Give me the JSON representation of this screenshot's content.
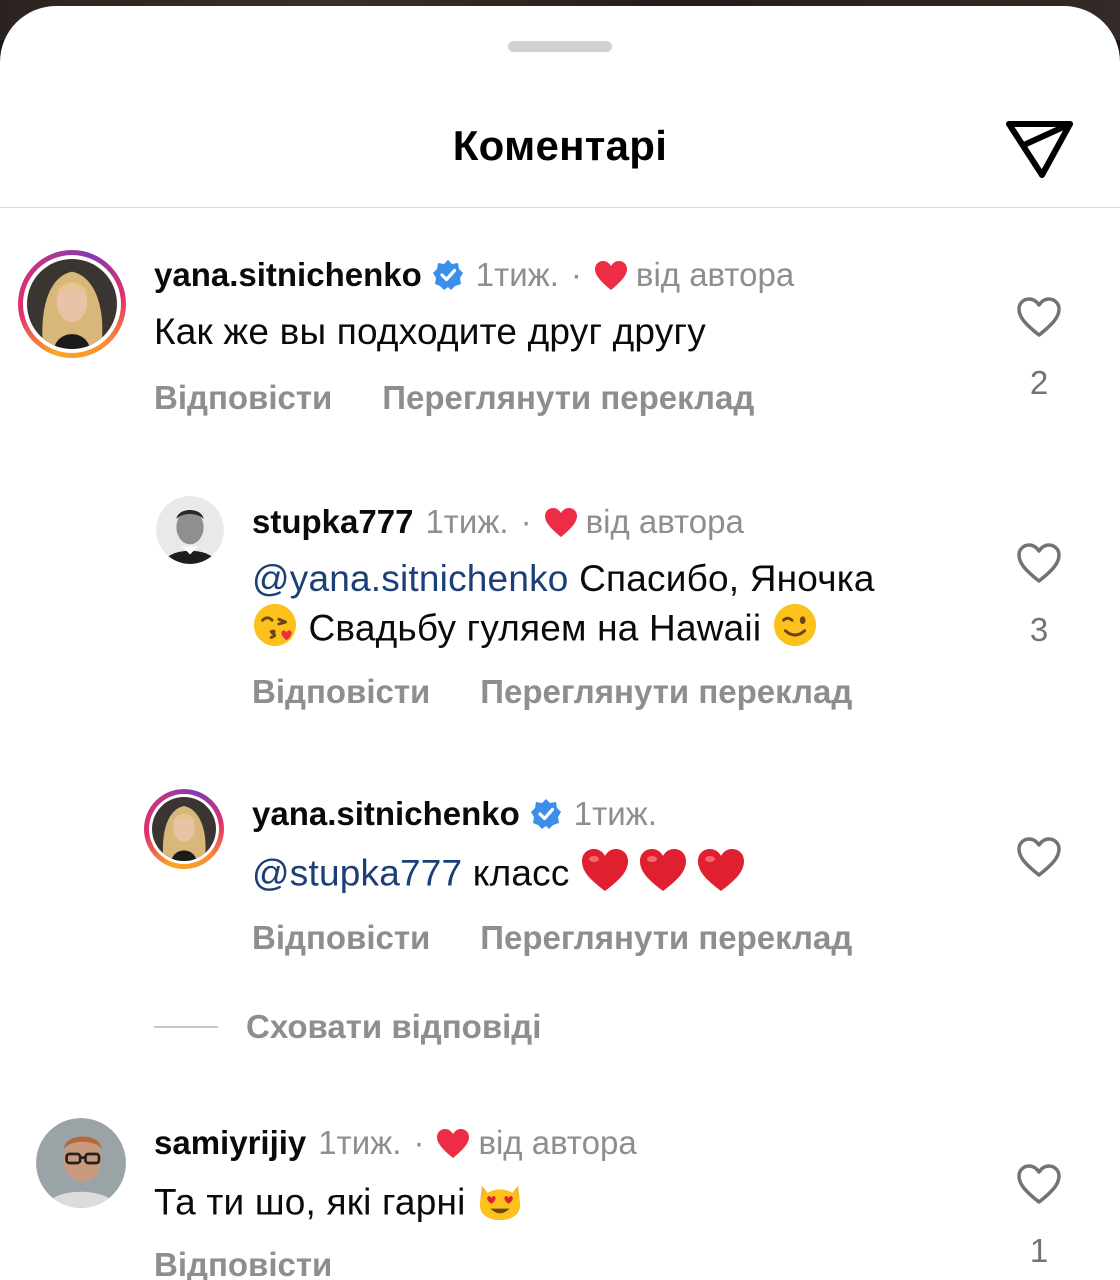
{
  "header": {
    "title": "Коментарі"
  },
  "comments": [
    {
      "username": "yana.sitnichenko",
      "time": "1тиж.",
      "dot": "·",
      "liked_by_author": "від автора",
      "text": "Как же вы подходите друг другу",
      "reply_label": "Відповісти",
      "translate_label": "Переглянути переклад",
      "like_count": "2"
    },
    {
      "username": "stupka777",
      "time": "1тиж.",
      "dot": "·",
      "liked_by_author": "від автора",
      "mention": "@yana.sitnichenko",
      "text_line1": " Спасибо, Яночка",
      "text_line2": " Свадьбу гуляем на Hawaii ",
      "reply_label": "Відповісти",
      "translate_label": "Переглянути переклад",
      "like_count": "3"
    },
    {
      "username": "yana.sitnichenko",
      "time": "1тиж.",
      "mention": "@stupka777",
      "text": " класс ",
      "reply_label": "Відповісти",
      "translate_label": "Переглянути переклад"
    },
    {
      "username": "samiyrijiy",
      "time": "1тиж.",
      "dot": "·",
      "liked_by_author": "від автора",
      "text": "Та ти шо, які гарні ",
      "reply_label": "Відповісти",
      "like_count": "1"
    }
  ],
  "hide_replies_label": "Сховати відповіді",
  "colors": {
    "heart_red": "#ed2d45",
    "verified_blue": "#3b8fe8",
    "mention_blue": "#1b3f76",
    "secondary_gray": "#8e8e8e"
  },
  "icons": [
    "share-icon",
    "verified-icon",
    "heart-filled-icon",
    "heart-outline-icon",
    "kiss-emoji",
    "wink-emoji",
    "red-heart-emoji",
    "heart-eyes-cat-emoji"
  ]
}
